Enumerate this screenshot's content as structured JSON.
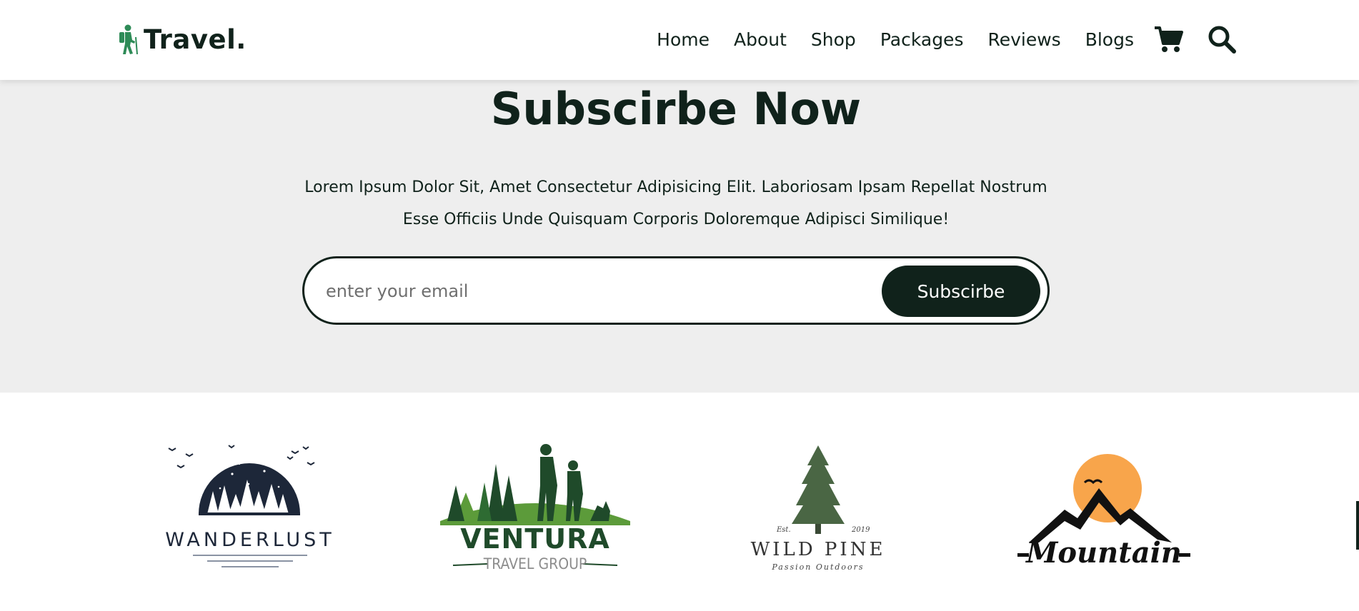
{
  "header": {
    "logo_text": "Travel.",
    "logo_icon": "hiker-icon",
    "nav": [
      {
        "label": "Home"
      },
      {
        "label": "About"
      },
      {
        "label": "Shop"
      },
      {
        "label": "Packages"
      },
      {
        "label": "Reviews"
      },
      {
        "label": "Blogs"
      }
    ],
    "icons": [
      "shopping-cart-icon",
      "search-icon"
    ]
  },
  "subscribe": {
    "title": "Subscirbe Now",
    "text_line1": "Lorem Ipsum Dolor Sit, Amet Consectetur Adipisicing Elit. Laboriosam Ipsam Repellat Nostrum",
    "text_line2": "Esse Officiis Unde Quisquam Corporis Doloremque Adipisci Similique!",
    "email_placeholder": "enter your email",
    "email_value": "",
    "button_label": "Subscirbe"
  },
  "brands": [
    {
      "name": "WANDERLUST"
    },
    {
      "name": "VENTURA",
      "tagline": "TRAVEL GROUP"
    },
    {
      "name": "WILD PINE",
      "est": "Est.",
      "year": "2019",
      "tagline": "Passion Outdoors"
    },
    {
      "name": "Mountain"
    }
  ],
  "colors": {
    "primary": "#10221b",
    "accent_green": "#2e8b57",
    "section_bg": "#eeeeee",
    "sun_orange": "#f8a54b"
  }
}
